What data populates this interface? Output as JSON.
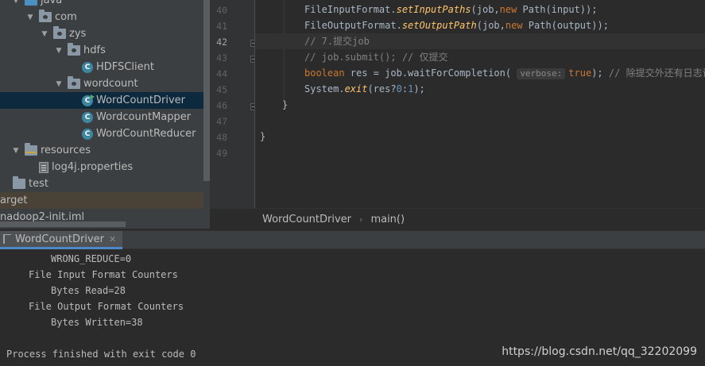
{
  "project_tree": {
    "items": [
      {
        "label": "java",
        "indent": 0,
        "kind": "src-folder",
        "arrow": "▼"
      },
      {
        "label": "com",
        "indent": 1,
        "kind": "package",
        "arrow": "▼"
      },
      {
        "label": "zys",
        "indent": 2,
        "kind": "package",
        "arrow": "▼"
      },
      {
        "label": "hdfs",
        "indent": 3,
        "kind": "package",
        "arrow": "▼"
      },
      {
        "label": "HDFSClient",
        "indent": 4,
        "kind": "class",
        "arrow": ""
      },
      {
        "label": "wordcount",
        "indent": 3,
        "kind": "package",
        "arrow": "▼"
      },
      {
        "label": "WordCountDriver",
        "indent": 4,
        "kind": "class-run",
        "arrow": "",
        "selected": true
      },
      {
        "label": "WordcountMapper",
        "indent": 4,
        "kind": "class",
        "arrow": ""
      },
      {
        "label": "WordCountReducer",
        "indent": 4,
        "kind": "class",
        "arrow": ""
      },
      {
        "label": "resources",
        "indent": 0,
        "kind": "res-folder",
        "arrow": "▼"
      },
      {
        "label": "log4j.properties",
        "indent": 1,
        "kind": "properties",
        "arrow": ""
      },
      {
        "label": "test",
        "indent": -1,
        "kind": "folder",
        "arrow": ""
      },
      {
        "label": "arget",
        "indent": -2,
        "kind": "none",
        "arrow": "",
        "highlight": true
      },
      {
        "label": "nadoop2-init.iml",
        "indent": -2,
        "kind": "none",
        "arrow": ""
      }
    ]
  },
  "editor": {
    "line_numbers": [
      "40",
      "41",
      "42",
      "43",
      "44",
      "45",
      "46",
      "47",
      "48",
      "49"
    ],
    "current_line": "42",
    "lines": [
      {
        "indent": 2,
        "parts": [
          [
            "",
            "FileInputFormat."
          ],
          [
            "fn",
            "setInputPaths"
          ],
          [
            "",
            "(job,"
          ],
          [
            "kw",
            "new "
          ],
          [
            "",
            "Path(input));"
          ]
        ]
      },
      {
        "indent": 2,
        "parts": [
          [
            "",
            "FileOutputFormat."
          ],
          [
            "fn",
            "setOutputPath"
          ],
          [
            "",
            "(job,"
          ],
          [
            "kw",
            "new "
          ],
          [
            "",
            "Path(output));"
          ]
        ]
      },
      {
        "indent": 2,
        "parts": [
          [
            "cm",
            "// 7.提交job"
          ]
        ]
      },
      {
        "indent": 2,
        "parts": [
          [
            "cm",
            "// job.submit(); // 仅提交"
          ]
        ]
      },
      {
        "indent": 2,
        "parts": [
          [
            "kw",
            "boolean "
          ],
          [
            "",
            "res = job.waitForCompletion( "
          ],
          [
            "hint",
            "verbose:"
          ],
          [
            "kw",
            "true"
          ],
          [
            "",
            "); "
          ],
          [
            "cm",
            "// 除提交外还有日志记录"
          ]
        ]
      },
      {
        "indent": 2,
        "parts": [
          [
            "",
            "System."
          ],
          [
            "fn",
            "exit"
          ],
          [
            "",
            "(res?"
          ],
          [
            "num",
            "0"
          ],
          [
            "",
            ":"
          ],
          [
            "num",
            "1"
          ],
          [
            "",
            ");"
          ]
        ]
      },
      {
        "indent": 1,
        "parts": [
          [
            "",
            "}"
          ]
        ]
      },
      {
        "indent": 0,
        "parts": [
          [
            "",
            ""
          ]
        ]
      },
      {
        "indent": 0,
        "parts": [
          [
            "",
            "}"
          ]
        ]
      },
      {
        "indent": 0,
        "parts": [
          [
            "",
            ""
          ]
        ]
      }
    ]
  },
  "breadcrumb": {
    "class_name": "WordCountDriver",
    "separator": "›",
    "method": "main()"
  },
  "run_panel": {
    "tab_label": "WordCountDriver",
    "close_glyph": "✕",
    "console_lines": [
      {
        "indent": 2,
        "text": "WRONG_REDUCE=0"
      },
      {
        "indent": 1,
        "text": "File Input Format Counters"
      },
      {
        "indent": 2,
        "text": "Bytes Read=28"
      },
      {
        "indent": 1,
        "text": "File Output Format Counters"
      },
      {
        "indent": 2,
        "text": "Bytes Written=38"
      },
      {
        "indent": 0,
        "text": ""
      },
      {
        "indent": 0,
        "text": "Process finished with exit code 0"
      }
    ]
  },
  "watermark": "https://blog.csdn.net/qq_32202099",
  "colors": {
    "keyword": "#cc7832",
    "method_italic": "#ffc66d",
    "comment": "#808080",
    "number": "#6897bb",
    "selection": "#0d293e",
    "tab_underline": "#4a88c7"
  }
}
